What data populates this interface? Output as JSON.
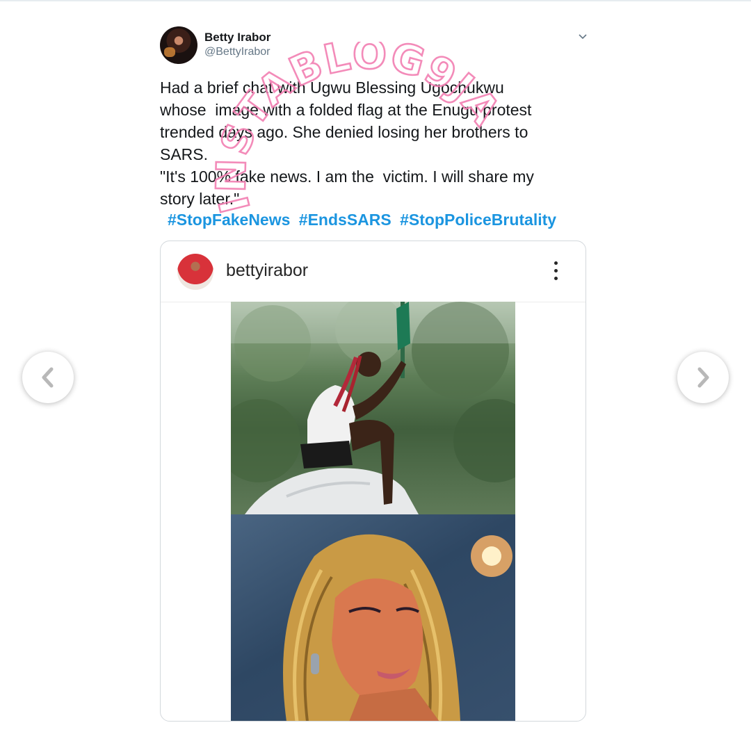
{
  "tweet": {
    "display_name": "Betty Irabor",
    "handle": "@BettyIrabor",
    "text_lines": [
      "Had a brief chat with Ugwu Blessing Ugochukwu",
      "whose  image with a folded flag at the Enugu protest",
      "trended days ago. She denied losing her brothers to",
      "SARS.",
      "\"It's 100% fake news. I am the  victim. I will share my",
      "story later.\""
    ],
    "hashtags": [
      "#StopFakeNews",
      "#EndsSARS",
      "#StopPoliceBrutality"
    ]
  },
  "watermark": {
    "text": "INSTABLOG9JA",
    "color": "#f27fb2"
  },
  "embed": {
    "username": "bettyirabor",
    "more_icon": "more-vertical-icon"
  },
  "nav": {
    "left_icon": "chevron-left-icon",
    "right_icon": "chevron-right-icon"
  },
  "colors": {
    "hashtag": "#1b95e0",
    "text": "#14171a",
    "muted": "#657786"
  }
}
